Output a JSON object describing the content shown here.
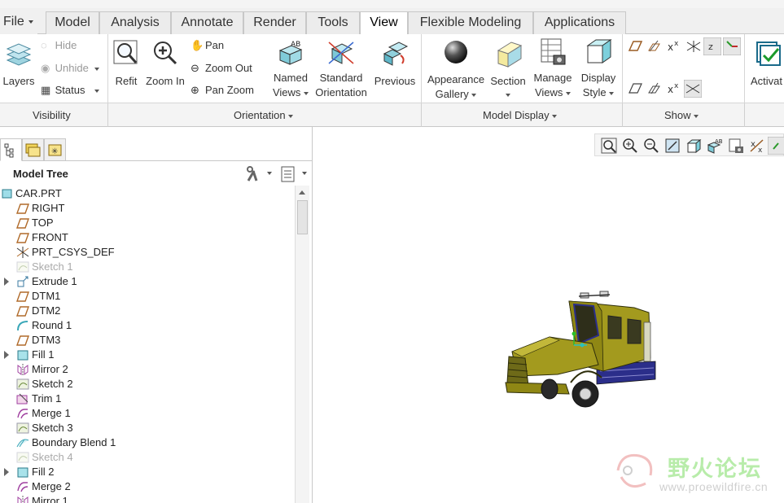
{
  "tabs": [
    {
      "label": "File",
      "active": false
    },
    {
      "label": "Model",
      "active": false
    },
    {
      "label": "Analysis",
      "active": false
    },
    {
      "label": "Annotate",
      "active": false
    },
    {
      "label": "Render",
      "active": false
    },
    {
      "label": "Tools",
      "active": false
    },
    {
      "label": "View",
      "active": true
    },
    {
      "label": "Flexible Modeling",
      "active": false
    },
    {
      "label": "Applications",
      "active": false
    }
  ],
  "ribbon": {
    "layers": "Layers",
    "hide": "Hide",
    "unhide": "Unhide",
    "status": "Status",
    "refit": "Refit",
    "zoom_in": "Zoom In",
    "pan": "Pan",
    "zoom_out": "Zoom Out",
    "pan_zoom": "Pan Zoom",
    "named_views_1": "Named",
    "named_views_2": "Views",
    "standard_orientation_1": "Standard",
    "standard_orientation_2": "Orientation",
    "previous": "Previous",
    "appearance_gallery_1": "Appearance",
    "appearance_gallery_2": "Gallery",
    "section": "Section",
    "manage_views_1": "Manage",
    "manage_views_2": "Views",
    "display_style_1": "Display",
    "display_style_2": "Style",
    "activate": "Activat"
  },
  "groups": {
    "visibility": "Visibility",
    "orientation": "Orientation",
    "model_display": "Model Display",
    "show": "Show"
  },
  "model_tree": {
    "title": "Model Tree",
    "items": [
      {
        "label": "CAR.PRT",
        "icon": "part-icon",
        "expandable": false,
        "dim": false,
        "root": true
      },
      {
        "label": "RIGHT",
        "icon": "datum-plane-icon",
        "expandable": false,
        "dim": false
      },
      {
        "label": "TOP",
        "icon": "datum-plane-icon",
        "expandable": false,
        "dim": false
      },
      {
        "label": "FRONT",
        "icon": "datum-plane-icon",
        "expandable": false,
        "dim": false
      },
      {
        "label": "PRT_CSYS_DEF",
        "icon": "csys-icon",
        "expandable": false,
        "dim": false
      },
      {
        "label": "Sketch 1",
        "icon": "sketch-icon",
        "expandable": false,
        "dim": true
      },
      {
        "label": "Extrude 1",
        "icon": "extrude-icon",
        "expandable": true,
        "dim": false
      },
      {
        "label": "DTM1",
        "icon": "datum-plane-icon",
        "expandable": false,
        "dim": false
      },
      {
        "label": "DTM2",
        "icon": "datum-plane-icon",
        "expandable": false,
        "dim": false
      },
      {
        "label": "Round 1",
        "icon": "round-icon",
        "expandable": false,
        "dim": false
      },
      {
        "label": "DTM3",
        "icon": "datum-plane-icon",
        "expandable": false,
        "dim": false
      },
      {
        "label": "Fill 1",
        "icon": "fill-icon",
        "expandable": true,
        "dim": false
      },
      {
        "label": "Mirror 2",
        "icon": "mirror-icon",
        "expandable": false,
        "dim": false
      },
      {
        "label": "Sketch 2",
        "icon": "sketch-icon",
        "expandable": false,
        "dim": false
      },
      {
        "label": "Trim 1",
        "icon": "trim-icon",
        "expandable": false,
        "dim": false
      },
      {
        "label": "Merge 1",
        "icon": "merge-icon",
        "expandable": false,
        "dim": false
      },
      {
        "label": "Sketch 3",
        "icon": "sketch-icon",
        "expandable": false,
        "dim": false
      },
      {
        "label": "Boundary Blend 1",
        "icon": "boundary-blend-icon",
        "expandable": false,
        "dim": false
      },
      {
        "label": "Sketch 4",
        "icon": "sketch-icon",
        "expandable": false,
        "dim": true
      },
      {
        "label": "Fill 2",
        "icon": "fill-icon",
        "expandable": true,
        "dim": false
      },
      {
        "label": "Merge 2",
        "icon": "merge-icon",
        "expandable": false,
        "dim": false
      },
      {
        "label": "Mirror 1",
        "icon": "mirror-icon",
        "expandable": false,
        "dim": false
      }
    ]
  },
  "watermark": {
    "text": "野火论坛",
    "url": "www.proewildfire.cn"
  },
  "colors": {
    "model_body": "#a39a1e",
    "model_frame": "#2b2e8a",
    "datum_icon": "#b06a2a",
    "accent_teal": "#3aa7b8"
  }
}
